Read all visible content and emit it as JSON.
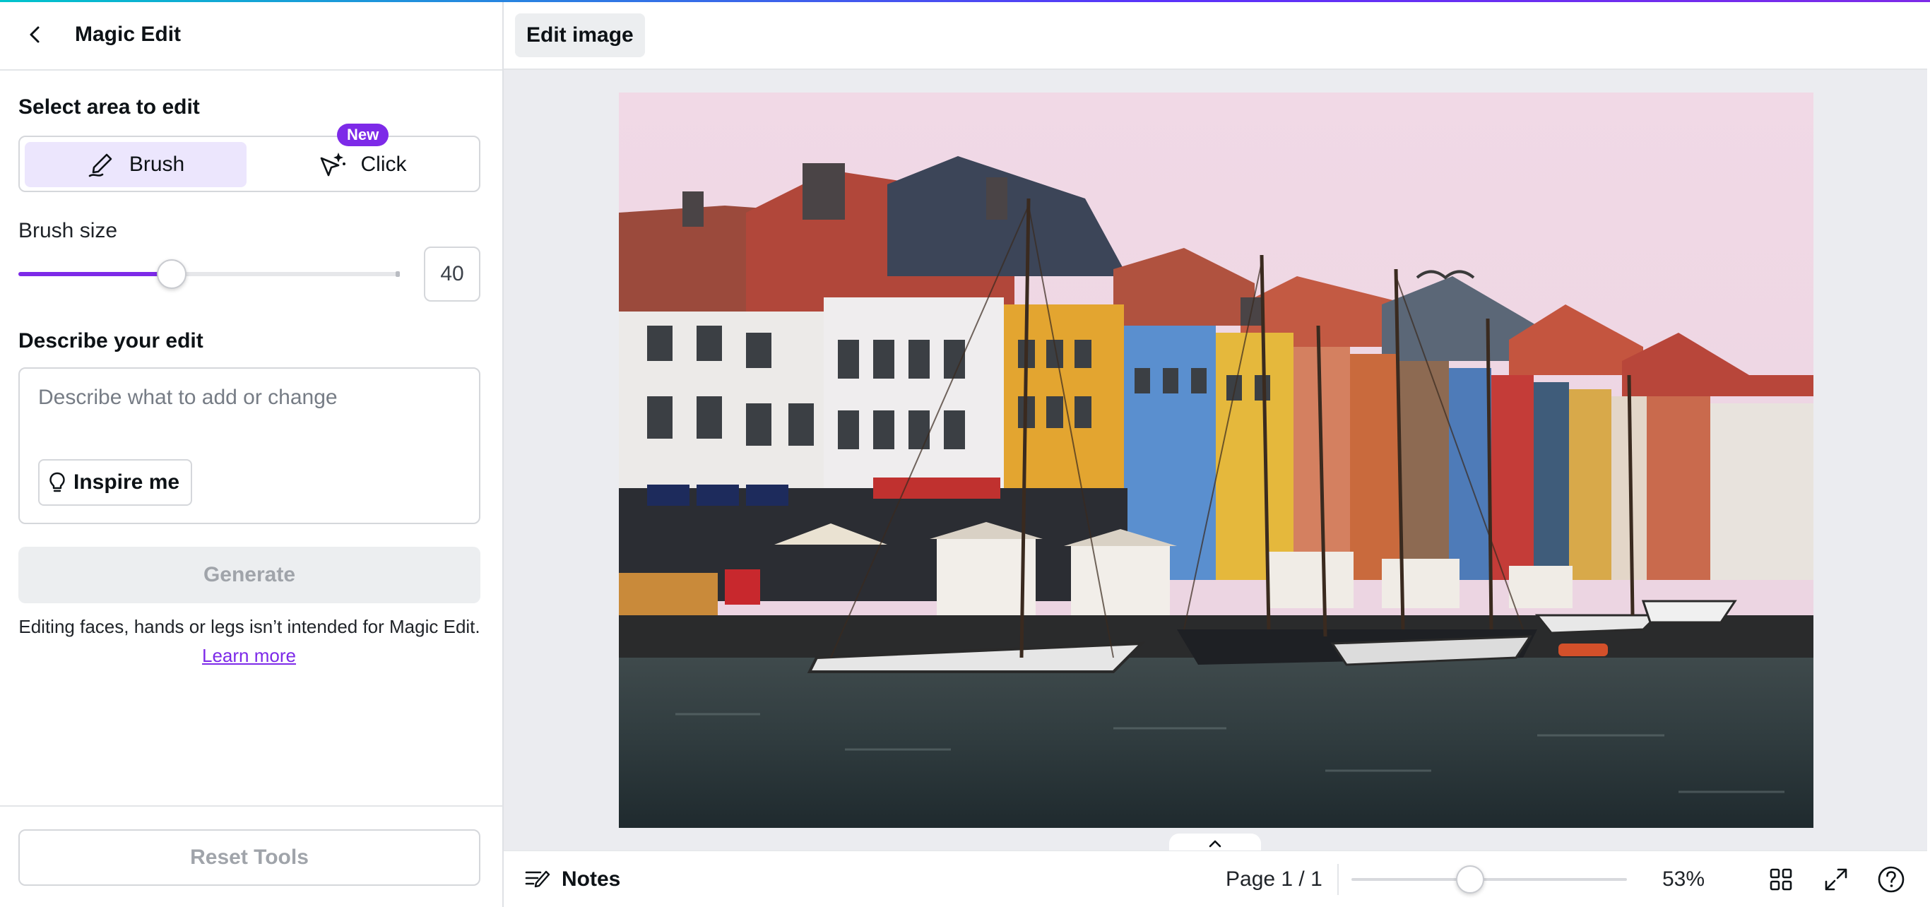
{
  "panel": {
    "title": "Magic Edit",
    "select_area_label": "Select area to edit",
    "modes": [
      {
        "label": "Brush",
        "icon": "brush-icon",
        "selected": true
      },
      {
        "label": "Click",
        "icon": "sparkle-cursor-icon",
        "selected": false,
        "badge": "New"
      }
    ],
    "brush_size_label": "Brush size",
    "brush_size_value": "40",
    "describe_label": "Describe your edit",
    "prompt_placeholder": "Describe what to add or change",
    "inspire_label": "Inspire me",
    "generate_label": "Generate",
    "disclaimer": "Editing faces, hands or legs isn’t intended for Magic Edit.",
    "learn_more": "Learn more",
    "reset_label": "Reset Tools"
  },
  "topbar": {
    "edit_image_label": "Edit image"
  },
  "bottombar": {
    "notes_label": "Notes",
    "page_info": "Page 1 / 1",
    "zoom_level": "53%",
    "zoom_fraction": 0.43
  },
  "colors": {
    "accent": "#7d2ae8",
    "selected_bg": "#ece6fd"
  }
}
